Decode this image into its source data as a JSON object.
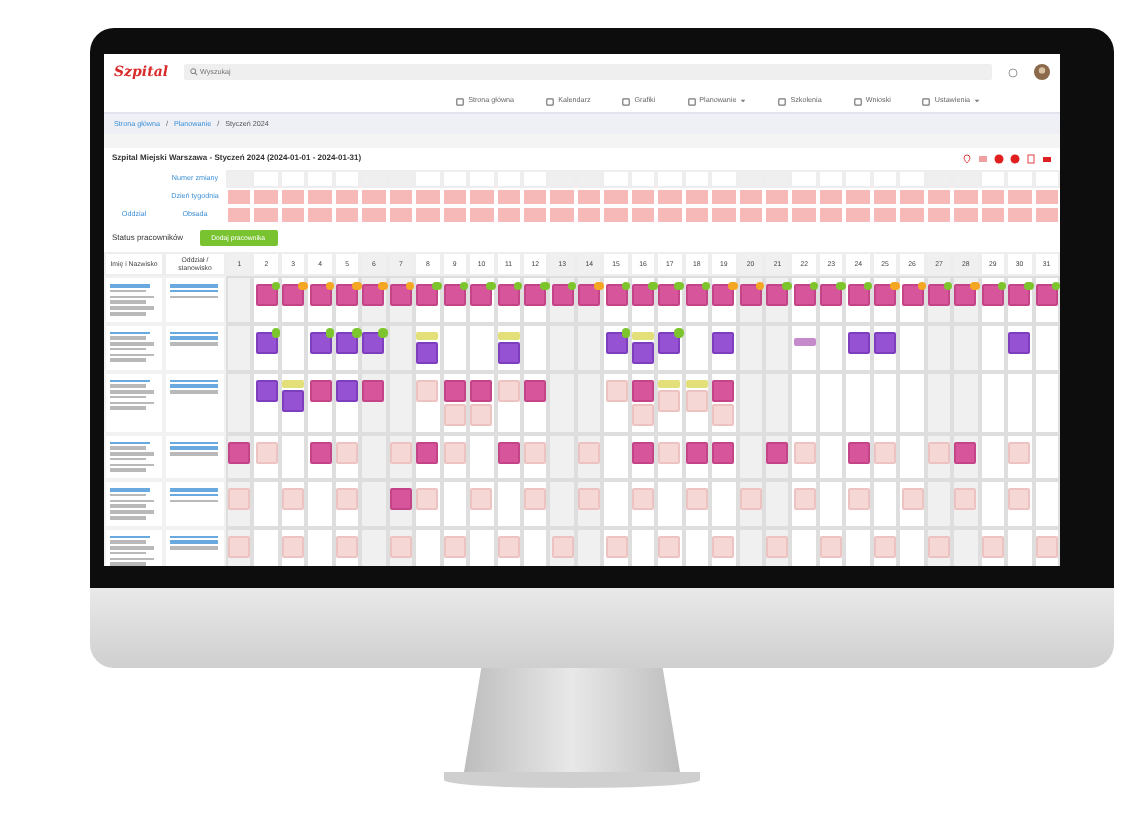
{
  "app": {
    "logo": "Szpital",
    "search": {
      "placeholder": "Wyszukaj"
    }
  },
  "nav": [
    {
      "label": "Strona główna",
      "dropdown": false
    },
    {
      "label": "Kalendarz",
      "dropdown": false
    },
    {
      "label": "Grafiki",
      "dropdown": false
    },
    {
      "label": "Planowanie",
      "dropdown": true
    },
    {
      "label": "Szkolenia",
      "dropdown": false
    },
    {
      "label": "Wnioski",
      "dropdown": false
    },
    {
      "label": "Ustawienia",
      "dropdown": true
    }
  ],
  "breadcrumb": [
    {
      "kind": "link",
      "text": "Strona główna"
    },
    {
      "kind": "separator",
      "text": "/"
    },
    {
      "kind": "link",
      "text": "Planowanie"
    },
    {
      "kind": "separator",
      "text": "/"
    },
    {
      "kind": "current",
      "text": "Styczeń 2024"
    }
  ],
  "title": "Szpital Miejski Warszawa - Styczeń 2024 (2024-01-01 - 2024-01-31)",
  "summary_group": "Oddział",
  "summary_rows": [
    {
      "label": "Numer zmiany",
      "kind": "plain"
    },
    {
      "label": "Dzień tygodnia",
      "kind": "alert"
    },
    {
      "label": "Obsada",
      "kind": "alert"
    }
  ],
  "section": {
    "title": "Status pracowników",
    "button": "Dodaj pracownika"
  },
  "grid_columns": [
    "Imię i Nazwisko",
    "Oddział / stanowisko"
  ],
  "days": [
    {
      "label": "1",
      "weekend": true
    },
    {
      "label": "2",
      "weekend": false
    },
    {
      "label": "3",
      "weekend": false
    },
    {
      "label": "4",
      "weekend": false
    },
    {
      "label": "5",
      "weekend": false
    },
    {
      "label": "6",
      "weekend": true
    },
    {
      "label": "7",
      "weekend": true
    },
    {
      "label": "8",
      "weekend": false
    },
    {
      "label": "9",
      "weekend": false
    },
    {
      "label": "10",
      "weekend": false
    },
    {
      "label": "11",
      "weekend": false
    },
    {
      "label": "12",
      "weekend": false
    },
    {
      "label": "13",
      "weekend": true
    },
    {
      "label": "14",
      "weekend": true
    },
    {
      "label": "15",
      "weekend": false
    },
    {
      "label": "16",
      "weekend": false
    },
    {
      "label": "17",
      "weekend": false
    },
    {
      "label": "18",
      "weekend": false
    },
    {
      "label": "19",
      "weekend": false
    },
    {
      "label": "20",
      "weekend": true
    },
    {
      "label": "21",
      "weekend": true
    },
    {
      "label": "22",
      "weekend": false
    },
    {
      "label": "23",
      "weekend": false
    },
    {
      "label": "24",
      "weekend": false
    },
    {
      "label": "25",
      "weekend": false
    },
    {
      "label": "26",
      "weekend": false
    },
    {
      "label": "27",
      "weekend": true
    },
    {
      "label": "28",
      "weekend": true
    },
    {
      "label": "29",
      "weekend": false
    },
    {
      "label": "30",
      "weekend": false
    },
    {
      "label": "31",
      "weekend": false
    }
  ],
  "employees": [
    {
      "shifts": [
        {
          "kind": "empty"
        },
        {
          "kind": "day",
          "color": "#7cc52d"
        },
        {
          "kind": "day",
          "color": "#f5a623"
        },
        {
          "kind": "day",
          "color": "#f5a623"
        },
        {
          "kind": "day",
          "color": "#f5a623"
        },
        {
          "kind": "day",
          "color": "#f5a623"
        },
        {
          "kind": "day",
          "color": "#f5a623"
        },
        {
          "kind": "day",
          "color": "#7cc52d"
        },
        {
          "kind": "day",
          "color": "#7cc52d"
        },
        {
          "kind": "day",
          "color": "#7cc52d"
        },
        {
          "kind": "day",
          "color": "#7cc52d"
        },
        {
          "kind": "day",
          "color": "#7cc52d"
        },
        {
          "kind": "day",
          "color": "#7cc52d"
        },
        {
          "kind": "day",
          "color": "#f5a623"
        },
        {
          "kind": "day",
          "color": "#7cc52d"
        },
        {
          "kind": "day",
          "color": "#7cc52d"
        },
        {
          "kind": "day",
          "color": "#7cc52d"
        },
        {
          "kind": "day",
          "color": "#7cc52d"
        },
        {
          "kind": "day",
          "color": "#f5a623"
        },
        {
          "kind": "day",
          "color": "#f5a623"
        },
        {
          "kind": "day",
          "color": "#7cc52d"
        },
        {
          "kind": "day",
          "color": "#7cc52d"
        },
        {
          "kind": "day",
          "color": "#7cc52d"
        },
        {
          "kind": "day",
          "color": "#7cc52d"
        },
        {
          "kind": "day",
          "color": "#f5a623"
        },
        {
          "kind": "day",
          "color": "#f5a623"
        },
        {
          "kind": "day",
          "color": "#7cc52d"
        },
        {
          "kind": "day",
          "color": "#f5a623"
        },
        {
          "kind": "day",
          "color": "#7cc52d"
        },
        {
          "kind": "day",
          "color": "#7cc52d"
        },
        {
          "kind": "day",
          "color": "#7cc52d"
        }
      ]
    },
    {
      "shifts": [
        {
          "kind": "empty"
        },
        {
          "kind": "night",
          "color": "#7cc52d"
        },
        {
          "kind": "empty"
        },
        {
          "kind": "night",
          "color": "#7cc52d"
        },
        {
          "kind": "night",
          "color": "#7cc52d"
        },
        {
          "kind": "night",
          "color": "#7cc52d"
        },
        {
          "kind": "empty"
        },
        {
          "kind": "tag-night"
        },
        {
          "kind": "empty"
        },
        {
          "kind": "empty"
        },
        {
          "kind": "tag-night"
        },
        {
          "kind": "empty"
        },
        {
          "kind": "empty"
        },
        {
          "kind": "empty"
        },
        {
          "kind": "night",
          "color": "#7cc52d"
        },
        {
          "kind": "tag-night"
        },
        {
          "kind": "night",
          "color": "#7cc52d"
        },
        {
          "kind": "empty"
        },
        {
          "kind": "night"
        },
        {
          "kind": "empty"
        },
        {
          "kind": "empty"
        },
        {
          "kind": "leave"
        },
        {
          "kind": "empty"
        },
        {
          "kind": "night"
        },
        {
          "kind": "night"
        },
        {
          "kind": "empty"
        },
        {
          "kind": "empty"
        },
        {
          "kind": "empty"
        },
        {
          "kind": "empty"
        },
        {
          "kind": "night"
        },
        {
          "kind": "empty"
        }
      ]
    },
    {
      "shifts": [
        {
          "kind": "empty"
        },
        {
          "kind": "night"
        },
        {
          "kind": "tag-night"
        },
        {
          "kind": "day"
        },
        {
          "kind": "night"
        },
        {
          "kind": "day"
        },
        {
          "kind": "empty"
        },
        {
          "kind": "request"
        },
        {
          "kind": "day-request"
        },
        {
          "kind": "day-request"
        },
        {
          "kind": "request"
        },
        {
          "kind": "day"
        },
        {
          "kind": "empty"
        },
        {
          "kind": "empty"
        },
        {
          "kind": "request"
        },
        {
          "kind": "day-request"
        },
        {
          "kind": "tag-request"
        },
        {
          "kind": "tag-request"
        },
        {
          "kind": "day-request"
        },
        {
          "kind": "empty"
        },
        {
          "kind": "empty"
        },
        {
          "kind": "empty"
        },
        {
          "kind": "empty"
        },
        {
          "kind": "empty"
        },
        {
          "kind": "empty"
        },
        {
          "kind": "empty"
        },
        {
          "kind": "empty"
        },
        {
          "kind": "empty"
        },
        {
          "kind": "empty"
        },
        {
          "kind": "empty"
        },
        {
          "kind": "empty"
        }
      ]
    },
    {
      "shifts": [
        {
          "kind": "day"
        },
        {
          "kind": "request"
        },
        {
          "kind": "empty"
        },
        {
          "kind": "day"
        },
        {
          "kind": "request"
        },
        {
          "kind": "empty"
        },
        {
          "kind": "request"
        },
        {
          "kind": "day"
        },
        {
          "kind": "request"
        },
        {
          "kind": "empty"
        },
        {
          "kind": "day"
        },
        {
          "kind": "request"
        },
        {
          "kind": "empty"
        },
        {
          "kind": "request"
        },
        {
          "kind": "empty"
        },
        {
          "kind": "day"
        },
        {
          "kind": "request"
        },
        {
          "kind": "day"
        },
        {
          "kind": "day"
        },
        {
          "kind": "empty"
        },
        {
          "kind": "day"
        },
        {
          "kind": "request"
        },
        {
          "kind": "empty"
        },
        {
          "kind": "day"
        },
        {
          "kind": "request"
        },
        {
          "kind": "empty"
        },
        {
          "kind": "request"
        },
        {
          "kind": "day"
        },
        {
          "kind": "empty"
        },
        {
          "kind": "request"
        },
        {
          "kind": "empty"
        }
      ]
    },
    {
      "shifts": [
        {
          "kind": "request"
        },
        {
          "kind": "empty"
        },
        {
          "kind": "request"
        },
        {
          "kind": "empty"
        },
        {
          "kind": "request"
        },
        {
          "kind": "empty"
        },
        {
          "kind": "day"
        },
        {
          "kind": "request"
        },
        {
          "kind": "empty"
        },
        {
          "kind": "request"
        },
        {
          "kind": "empty"
        },
        {
          "kind": "request"
        },
        {
          "kind": "empty"
        },
        {
          "kind": "request"
        },
        {
          "kind": "empty"
        },
        {
          "kind": "request"
        },
        {
          "kind": "empty"
        },
        {
          "kind": "request"
        },
        {
          "kind": "empty"
        },
        {
          "kind": "request"
        },
        {
          "kind": "empty"
        },
        {
          "kind": "request"
        },
        {
          "kind": "empty"
        },
        {
          "kind": "request"
        },
        {
          "kind": "empty"
        },
        {
          "kind": "request"
        },
        {
          "kind": "empty"
        },
        {
          "kind": "request"
        },
        {
          "kind": "empty"
        },
        {
          "kind": "request"
        },
        {
          "kind": "empty"
        }
      ]
    },
    {
      "shifts": [
        {
          "kind": "request"
        },
        {
          "kind": "empty"
        },
        {
          "kind": "request"
        },
        {
          "kind": "empty"
        },
        {
          "kind": "request"
        },
        {
          "kind": "empty"
        },
        {
          "kind": "request"
        },
        {
          "kind": "empty"
        },
        {
          "kind": "request"
        },
        {
          "kind": "empty"
        },
        {
          "kind": "request"
        },
        {
          "kind": "empty"
        },
        {
          "kind": "request"
        },
        {
          "kind": "empty"
        },
        {
          "kind": "request"
        },
        {
          "kind": "empty"
        },
        {
          "kind": "request"
        },
        {
          "kind": "empty"
        },
        {
          "kind": "request"
        },
        {
          "kind": "empty"
        },
        {
          "kind": "request"
        },
        {
          "kind": "empty"
        },
        {
          "kind": "request"
        },
        {
          "kind": "empty"
        },
        {
          "kind": "request"
        },
        {
          "kind": "empty"
        },
        {
          "kind": "request"
        },
        {
          "kind": "empty"
        },
        {
          "kind": "request"
        },
        {
          "kind": "empty"
        },
        {
          "kind": "request"
        }
      ]
    }
  ]
}
